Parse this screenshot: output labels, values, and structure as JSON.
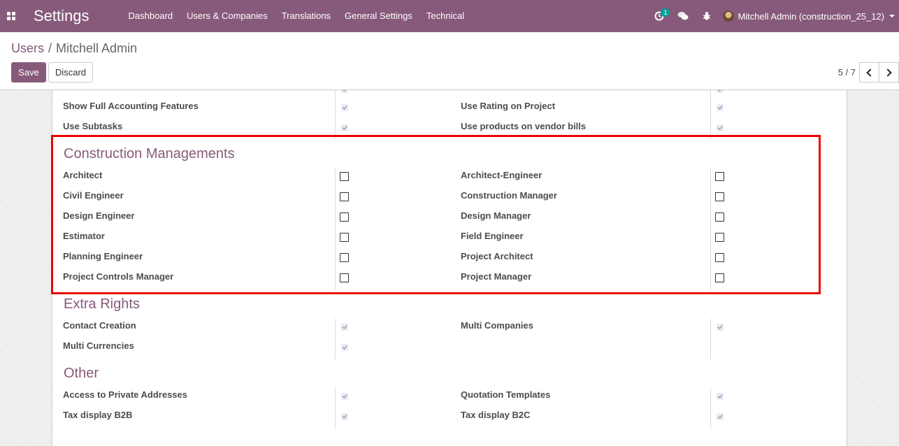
{
  "navbar": {
    "app_title": "Settings",
    "menu": [
      "Dashboard",
      "Users & Companies",
      "Translations",
      "General Settings",
      "Technical"
    ],
    "activity_badge": "1",
    "user_name": "Mitchell Admin (construction_25_12)"
  },
  "breadcrumb": {
    "parent": "Users",
    "separator": "/",
    "current": "Mitchell Admin"
  },
  "buttons": {
    "save": "Save",
    "discard": "Discard"
  },
  "pager": {
    "value": "5 / 7"
  },
  "top_rows": [
    {
      "left": "Show Full Accounting Features",
      "left_checked": true,
      "right": "Use Rating on Project",
      "right_checked": true
    },
    {
      "left": "Use Subtasks",
      "left_checked": true,
      "right": "Use products on vendor bills",
      "right_checked": true
    }
  ],
  "sections": [
    {
      "title": "Construction Managements",
      "editable": true,
      "rows": [
        {
          "left": "Architect",
          "left_checked": false,
          "right": "Architect-Engineer",
          "right_checked": false
        },
        {
          "left": "Civil Engineer",
          "left_checked": false,
          "right": "Construction Manager",
          "right_checked": false
        },
        {
          "left": "Design Engineer",
          "left_checked": false,
          "right": "Design Manager",
          "right_checked": false
        },
        {
          "left": "Estimator",
          "left_checked": false,
          "right": "Field Engineer",
          "right_checked": false
        },
        {
          "left": "Planning Engineer",
          "left_checked": false,
          "right": "Project Architect",
          "right_checked": false
        },
        {
          "left": "Project Controls Manager",
          "left_checked": false,
          "right": "Project Manager",
          "right_checked": false
        }
      ]
    },
    {
      "title": "Extra Rights",
      "editable": false,
      "rows": [
        {
          "left": "Contact Creation",
          "left_checked": true,
          "right": "Multi Companies",
          "right_checked": true
        },
        {
          "left": "Multi Currencies",
          "left_checked": true,
          "right": "",
          "right_checked": null
        }
      ]
    },
    {
      "title": "Other",
      "editable": false,
      "rows": [
        {
          "left": "Access to Private Addresses",
          "left_checked": true,
          "right": "Quotation Templates",
          "right_checked": true
        },
        {
          "left": "Tax display B2B",
          "left_checked": true,
          "right": "Tax display B2C",
          "right_checked": true
        }
      ]
    }
  ],
  "colors": {
    "brand": "#875a7b",
    "highlight": "#ee0000"
  }
}
